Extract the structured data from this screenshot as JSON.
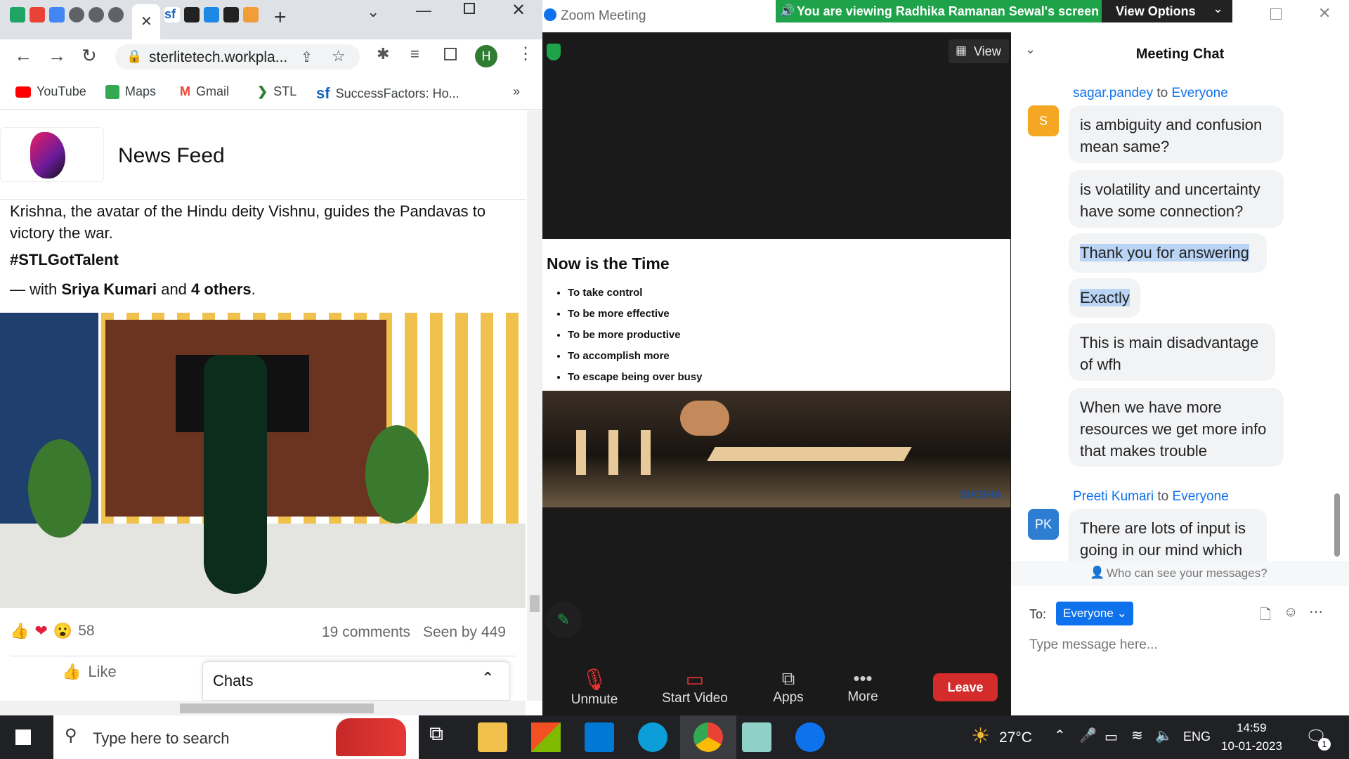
{
  "chrome": {
    "tabs": [
      "sheets-app",
      "gmail",
      "calendar",
      "browser-globe",
      "browser-globe",
      "browser-globe",
      "active-tab",
      "successfactors",
      "app-dark",
      "trello",
      "app-dark",
      "app-orange"
    ],
    "close_tab": "✕",
    "new_tab": "+",
    "url": "sterlitetech.workpla...",
    "profile_initial": "H",
    "bookmarks": [
      "YouTube",
      "Maps",
      "Gmail",
      "STL",
      "SuccessFactors: Ho..."
    ],
    "bookmarks_more": "»"
  },
  "feed": {
    "group_title": "News Feed",
    "post_text": "Krishna, the avatar of the Hindu deity Vishnu, guides the Pandavas to victory the war.",
    "hashtag": "#STLGotTalent",
    "with_prefix": "— with ",
    "with_person": "Sriya Kumari",
    "with_and": " and ",
    "with_others": "4 others",
    "with_suffix": ".",
    "reaction_count": "58",
    "comments": "19 comments",
    "seen_by": "Seen by 449",
    "like_label": "Like",
    "chats_label": "Chats"
  },
  "zoom": {
    "window_title": "Zoom Meeting",
    "viewing_banner": "You are viewing Radhika Ramanan Sewal's screen",
    "view_options": "View Options",
    "view_button": "View",
    "slide": {
      "title": "Now is the Time",
      "bullets": [
        "To take control",
        "To be more effective",
        "To be more productive",
        "To accomplish more",
        "To escape being over busy"
      ],
      "watermark": "SIKSHA"
    },
    "controls": [
      "Unmute",
      "Start Video",
      "Apps",
      "More"
    ],
    "leave": "Leave",
    "chat": {
      "title": "Meeting Chat",
      "messages": [
        {
          "sender": "sagar.pandey",
          "to": "to",
          "recipient": "Everyone",
          "avatar": "S",
          "texts": [
            "is ambiguity and confusion mean same?",
            "is volatility and uncertainty have some connection?",
            "Thank you for answering",
            "Exactly",
            "This is main disadvantage of wfh",
            "When we have more resources we get more info that makes trouble"
          ]
        },
        {
          "sender": "Preeti Kumari",
          "to": "to",
          "recipient": "Everyone",
          "avatar": "PK",
          "texts": [
            "There are lots of input is going in our mind which"
          ]
        }
      ],
      "who_can_see": "Who can see your messages?",
      "to_label": "To:",
      "to_value": "Everyone",
      "placeholder": "Type message here..."
    }
  },
  "taskbar": {
    "search_placeholder": "Type here to search",
    "weather": "27°C",
    "lang": "ENG",
    "time": "14:59",
    "date": "10-01-2023",
    "notif_count": "1"
  },
  "colors": {
    "zoom_green": "#1ea34a",
    "zoom_blue": "#0e72ed",
    "leave_red": "#d42b2b",
    "chat_avatar_orange": "#f5a623",
    "chat_avatar_blue": "#2d7dd2"
  }
}
